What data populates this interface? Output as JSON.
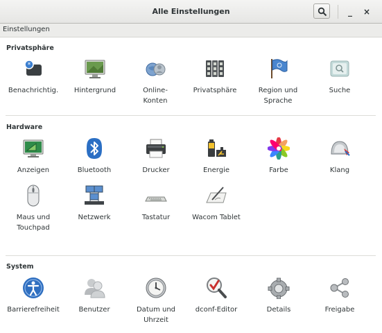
{
  "window": {
    "title": "Alle Einstellungen"
  },
  "breadcrumb": "Einstellungen",
  "sections": {
    "privacy": {
      "title": "Privatsphäre",
      "items": [
        {
          "label": "Benachrichtig.",
          "icon": "notification-icon"
        },
        {
          "label": "Hintergrund",
          "icon": "background-icon"
        },
        {
          "label": "Online-\nKonten",
          "icon": "online-accounts-icon"
        },
        {
          "label": "Privatsphäre",
          "icon": "privacy-icon"
        },
        {
          "label": "Region und\nSprache",
          "icon": "region-flag-icon"
        },
        {
          "label": "Suche",
          "icon": "search-settings-icon"
        }
      ]
    },
    "hardware": {
      "title": "Hardware",
      "items": [
        {
          "label": "Anzeigen",
          "icon": "display-icon"
        },
        {
          "label": "Bluetooth",
          "icon": "bluetooth-icon"
        },
        {
          "label": "Drucker",
          "icon": "printer-icon"
        },
        {
          "label": "Energie",
          "icon": "power-icon"
        },
        {
          "label": "Farbe",
          "icon": "color-icon"
        },
        {
          "label": "Klang",
          "icon": "sound-icon"
        },
        {
          "label": "Maus und\nTouchpad",
          "icon": "mouse-icon"
        },
        {
          "label": "Netzwerk",
          "icon": "network-icon"
        },
        {
          "label": "Tastatur",
          "icon": "keyboard-icon"
        },
        {
          "label": "Wacom Tablet",
          "icon": "wacom-tablet-icon"
        }
      ]
    },
    "system": {
      "title": "System",
      "items": [
        {
          "label": "Barrierefreiheit",
          "icon": "accessibility-icon"
        },
        {
          "label": "Benutzer",
          "icon": "users-icon"
        },
        {
          "label": "Datum und\nUhrzeit",
          "icon": "clock-icon"
        },
        {
          "label": "dconf-Editor",
          "icon": "dconf-editor-icon"
        },
        {
          "label": "Details",
          "icon": "gear-icon"
        },
        {
          "label": "Freigabe",
          "icon": "share-icon"
        }
      ]
    }
  }
}
